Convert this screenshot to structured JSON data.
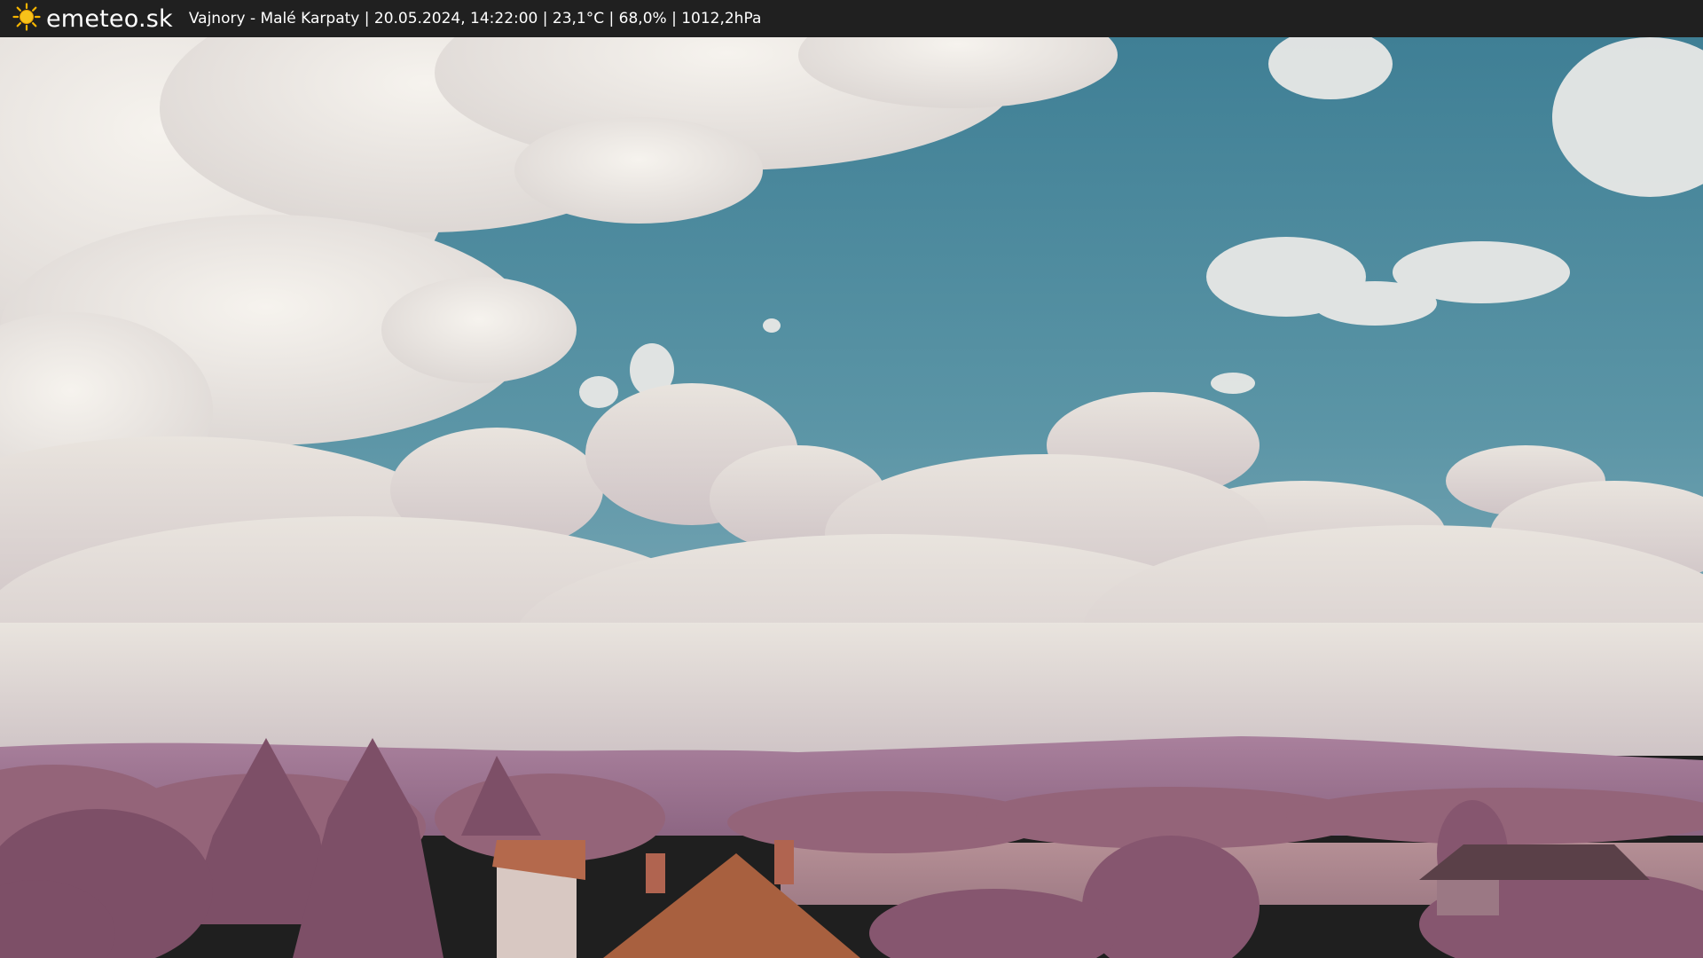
{
  "brand": {
    "logo_text": "emeteo.sk",
    "logo_icon": "sun-icon"
  },
  "caption": {
    "text": "Vajnory - Malé Karpaty | 20.05.2024, 14:22:00 | 23,1°C | 68,0% | 1012,2hPa"
  },
  "colors": {
    "bar_background": "#202020",
    "sky": "#4f8ea0",
    "cloud": "#efece6",
    "hills": "#9a6f8e",
    "foliage": "#8a5a74",
    "roof": "#b4694c"
  }
}
